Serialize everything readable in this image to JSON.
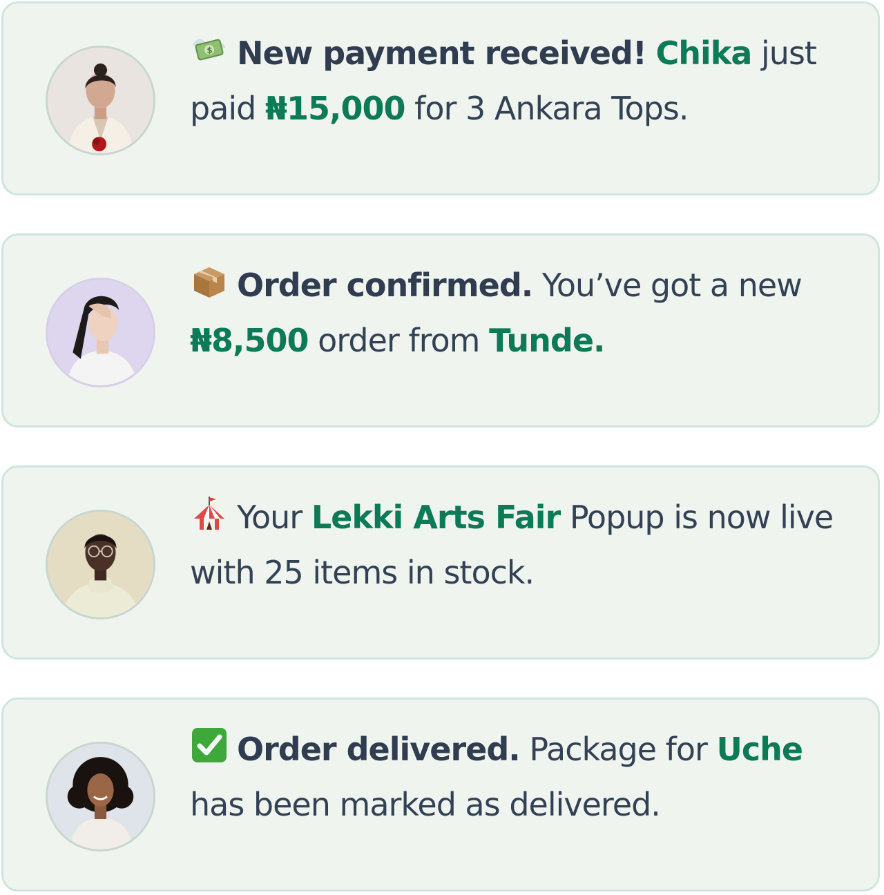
{
  "notifications": [
    {
      "emoji": "money-with-wings-icon",
      "title": "New payment received!",
      "name": "Chika",
      "text1": " just paid ",
      "amount": "₦15,000",
      "text2": " for 3 Ankara Tops."
    },
    {
      "emoji": "package-icon",
      "title": "Order confirmed.",
      "text1": " You’ve got a new ",
      "amount": "₦8,500",
      "text2": " order from ",
      "name": "Tunde."
    },
    {
      "emoji": "circus-tent-icon",
      "text1": "Your ",
      "event": "Lekki Arts Fair",
      "text2": " Popup is now live with 25 items in stock."
    },
    {
      "emoji": "check-mark-button-icon",
      "title": "Order delivered.",
      "text1": " Package for ",
      "name": "Uche",
      "text2": " has been marked as delivered."
    }
  ],
  "colors": {
    "card_bg": "#eff4ef",
    "card_border": "#cfe6dc",
    "text": "#334155",
    "accent": "#0d7a57"
  }
}
